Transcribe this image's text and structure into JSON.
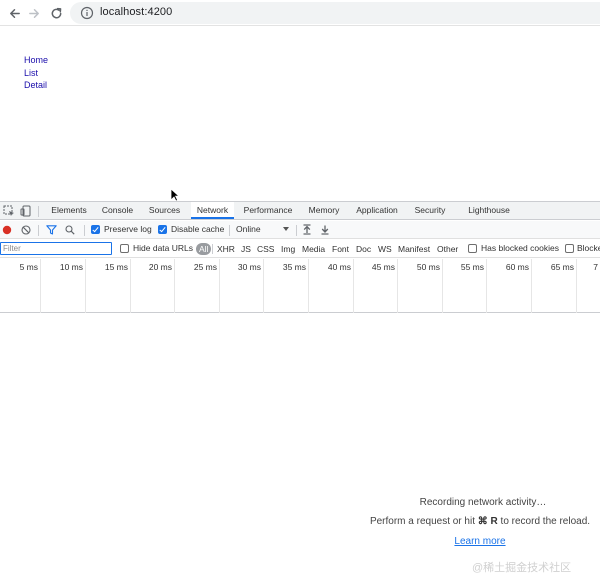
{
  "browser": {
    "url": "localhost:4200",
    "icons": [
      "back-arrow-icon",
      "forward-arrow-icon",
      "reload-icon",
      "info-icon"
    ]
  },
  "page": {
    "links": [
      "Home",
      "List",
      "Detail"
    ]
  },
  "devtools": {
    "tabs": [
      "Elements",
      "Console",
      "Sources",
      "Network",
      "Performance",
      "Memory",
      "Application",
      "Security",
      "Lighthouse"
    ],
    "active_tab": "Network",
    "toolbar": {
      "preserve_log_label": "Preserve log",
      "preserve_log_checked": true,
      "disable_cache_label": "Disable cache",
      "disable_cache_checked": true,
      "throttling_value": "Online",
      "record_color": "#d93025"
    },
    "filter": {
      "placeholder": "Filter",
      "hide_data_urls_label": "Hide data URLs",
      "types": [
        "All",
        "XHR",
        "JS",
        "CSS",
        "Img",
        "Media",
        "Font",
        "Doc",
        "WS",
        "Manifest",
        "Other"
      ],
      "active_type": "All",
      "has_blocked_cookies_label": "Has blocked cookies",
      "blocked_requests_label": "Blocke"
    },
    "timeline_ticks": [
      "5 ms",
      "10 ms",
      "15 ms",
      "20 ms",
      "25 ms",
      "30 ms",
      "35 ms",
      "40 ms",
      "45 ms",
      "50 ms",
      "55 ms",
      "60 ms",
      "65 ms",
      "7"
    ],
    "empty_state": {
      "line1": "Recording network activity…",
      "line2_prefix": "Perform a request or hit ",
      "line2_shortcut": "⌘ R",
      "line2_suffix": " to record the reload.",
      "learn_more": "Learn more"
    }
  },
  "watermark": "@稀土掘金技术社区",
  "colors": {
    "accent": "#1a73e8",
    "link": "#1a0dab",
    "tabbar_bg": "#f1f3f4"
  }
}
